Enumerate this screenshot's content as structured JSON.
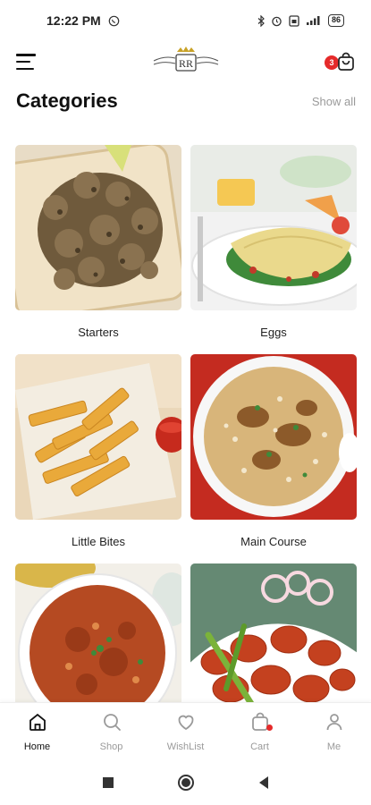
{
  "status_bar": {
    "time": "12:22 PM",
    "battery": "86"
  },
  "header": {
    "logo_text": "RR",
    "cart_count": "3"
  },
  "section": {
    "title": "Categories",
    "show_all": "Show all"
  },
  "categories": [
    {
      "label": "Starters"
    },
    {
      "label": "Eggs"
    },
    {
      "label": "Little Bites"
    },
    {
      "label": "Main Course"
    },
    {
      "label": ""
    },
    {
      "label": ""
    }
  ],
  "bottom_nav": {
    "items": [
      {
        "label": "Home",
        "icon": "home-icon",
        "active": true
      },
      {
        "label": "Shop",
        "icon": "search-icon"
      },
      {
        "label": "WishList",
        "icon": "heart-icon"
      },
      {
        "label": "Cart",
        "icon": "bag-icon"
      },
      {
        "label": "Me",
        "icon": "user-icon"
      }
    ]
  },
  "colors": {
    "accent": "#e52a2a",
    "inactive": "#9a9a9a"
  }
}
